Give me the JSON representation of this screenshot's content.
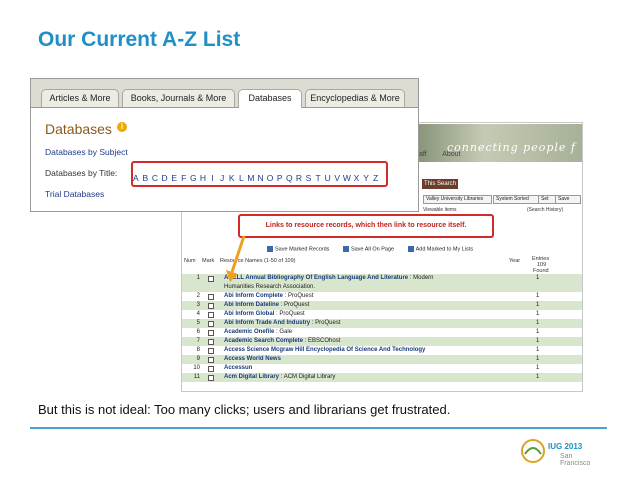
{
  "slide": {
    "title": "Our Current A-Z List",
    "caption": "But this is not ideal: Too many clicks; users and librarians get frustrated.",
    "logo_text": "IUG 2013",
    "logo_sub": "San Francisco"
  },
  "panel": {
    "tabs": [
      "Articles & More",
      "Books, Journals & More",
      "Databases",
      "Encyclopedias & More"
    ],
    "active_tab": "Databases",
    "title": "Databases",
    "info_glyph": "i",
    "by_subject": "Databases by Subject",
    "by_title_label": "Databases by Title:",
    "letters": [
      "A",
      "B",
      "C",
      "D",
      "E",
      "F",
      "G",
      "H",
      "I",
      "J",
      "K",
      "L",
      "M",
      "N",
      "O",
      "P",
      "Q",
      "R",
      "S",
      "T",
      "U",
      "V",
      "W",
      "X",
      "Y",
      "Z"
    ],
    "trial": "Trial Databases"
  },
  "catalog": {
    "banner": "connecting people f",
    "nav": [
      "aff",
      "About"
    ],
    "search_button": "This Search",
    "filter_library": "Valley University Libraries",
    "filter_sort": "System Sorted",
    "filter_set": "Set",
    "filter_save": "Save",
    "viewable_items": "Viewable items",
    "search_history": "(Search History)",
    "callout": "Links to resource records, which then link to resource itself.",
    "toolbar": [
      "Save Marked Records",
      "Save All On Page",
      "Add Marked to My Lists"
    ],
    "columns": {
      "num": "Num",
      "mark": "Mark",
      "names": "Resource Names (1-50 of 109)",
      "year": "Year",
      "entries": "Entries",
      "entries_count": "109",
      "found": "Found"
    },
    "rows": [
      {
        "num": "1",
        "name": "ABELL Annual Bibliography Of English Language And Literature",
        "provider": "Modern",
        "count": "1"
      },
      {
        "num": "",
        "name": "",
        "provider": "Humanities Research Association.",
        "count": ""
      },
      {
        "num": "2",
        "name": "Abi Inform Complete",
        "provider": "ProQuest",
        "count": "1"
      },
      {
        "num": "3",
        "name": "Abi Inform Dateline",
        "provider": "ProQuest",
        "count": "1"
      },
      {
        "num": "4",
        "name": "Abi Inform Global",
        "provider": "ProQuest",
        "count": "1"
      },
      {
        "num": "5",
        "name": "Abi Inform Trade And Industry",
        "provider": "ProQuest",
        "count": "1"
      },
      {
        "num": "6",
        "name": "Academic Onefile",
        "provider": "Gale",
        "count": "1"
      },
      {
        "num": "7",
        "name": "Academic Search Complete",
        "provider": "EBSCOhost",
        "count": "1"
      },
      {
        "num": "8",
        "name": "Access Science Mcgraw Hill Encyclopedia Of Science And Technology",
        "provider": "",
        "count": "1"
      },
      {
        "num": "9",
        "name": "Access World News",
        "provider": "",
        "count": "1"
      },
      {
        "num": "10",
        "name": "Accessun",
        "provider": "",
        "count": "1"
      },
      {
        "num": "11",
        "name": "Acm Digital Library",
        "provider": "ACM Digital Library",
        "count": "1"
      }
    ]
  },
  "colors": {
    "title_blue": "#1f8fc6",
    "highlight_red": "#d32a2a",
    "row_green": "#d7e6cc",
    "link_blue": "#1e3b8c",
    "panel_title": "#8a5a1a"
  }
}
